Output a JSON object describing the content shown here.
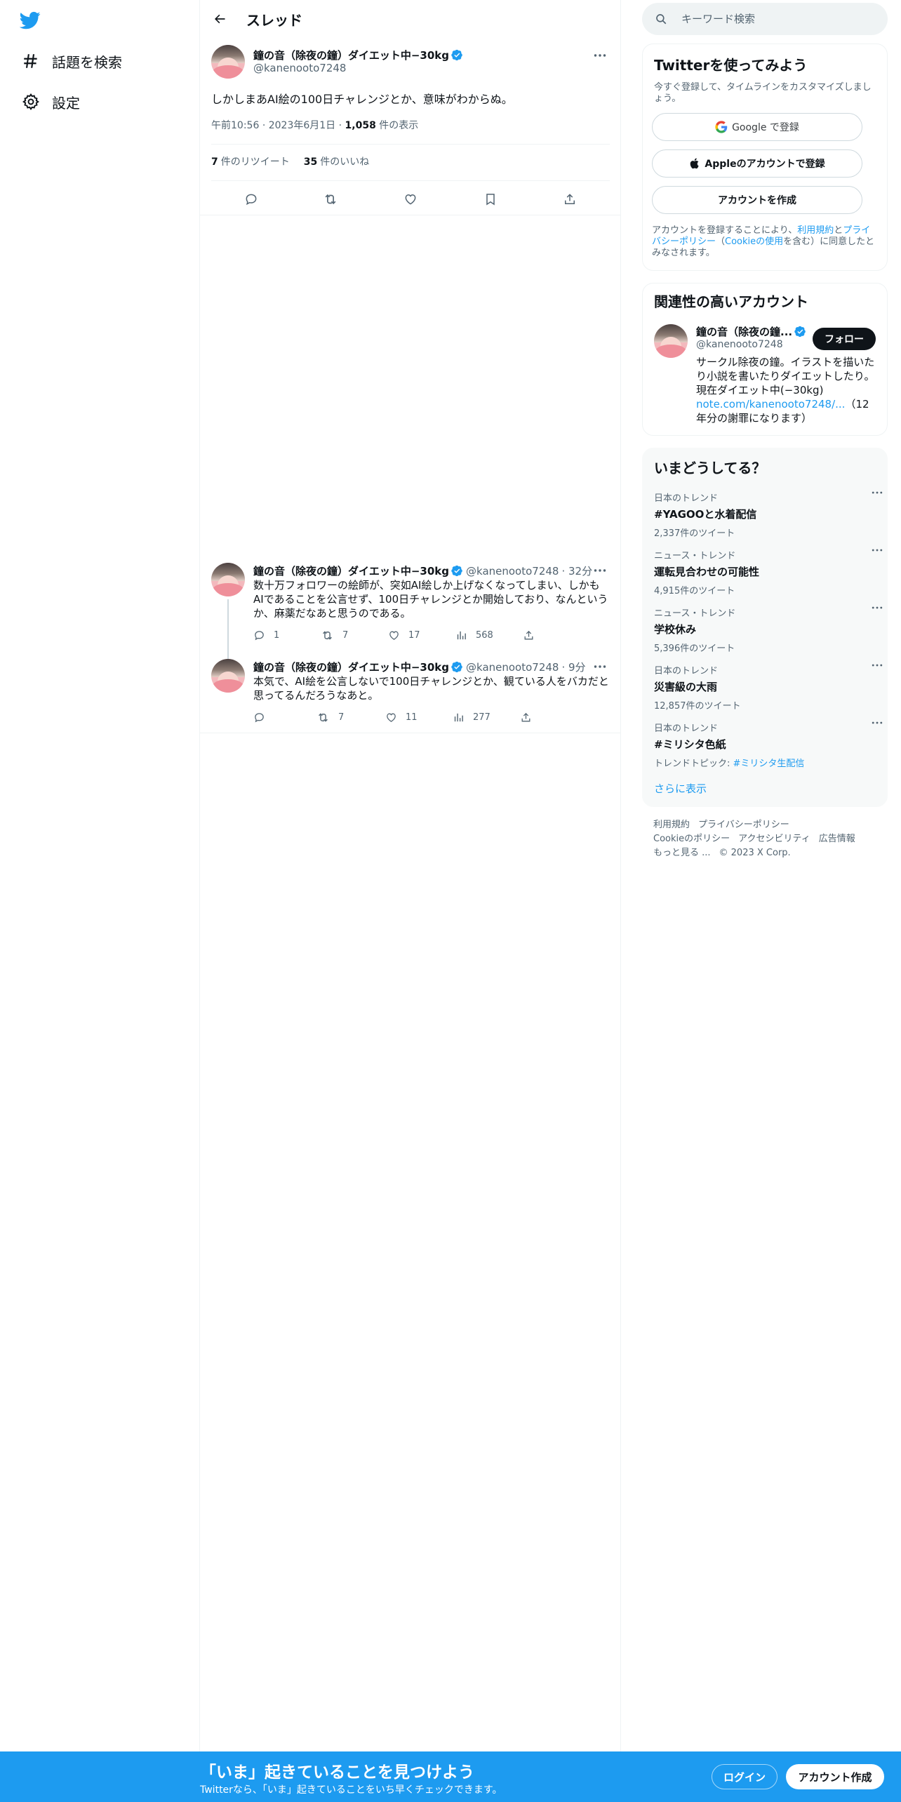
{
  "nav": {
    "explore_label": "話題を検索",
    "settings_label": "設定"
  },
  "thread": {
    "title": "スレッド",
    "focal": {
      "name": "鐘の音（除夜の鐘）ダイエット中−30kg",
      "handle": "@kanenooto7248",
      "text": "しかしまあAI絵の100日チャレンジとか、意味がわからぬ。",
      "time": "午前10:56",
      "date": "2023年6月1日",
      "views_count": "1,058",
      "views_label": " 件の表示",
      "retweets_count": "7",
      "retweets_label": "件のリツイート",
      "likes_count": "35",
      "likes_label": "件のいいね"
    },
    "replies": [
      {
        "name": "鐘の音（除夜の鐘）ダイエット中−30kg",
        "handle": "@kanenooto7248",
        "time": "· 32分",
        "text": "数十万フォロワーの絵師が、突如AI絵しか上げなくなってしまい、しかもAIであることを公言せず、100日チャレンジとか開始しており、なんというか、麻薬だなあと思うのである。",
        "replies": "1",
        "retweets": "7",
        "likes": "17",
        "views": "568"
      },
      {
        "name": "鐘の音（除夜の鐘）ダイエット中−30kg",
        "handle": "@kanenooto7248",
        "time": "· 9分",
        "text": "本気で、AI絵を公言しないで100日チャレンジとか、観ている人をバカだと思ってるんだろうなあと。",
        "replies": "",
        "retweets": "7",
        "likes": "11",
        "views": "277"
      }
    ]
  },
  "search": {
    "placeholder": "キーワード検索"
  },
  "signup": {
    "title": "Twitterを使ってみよう",
    "subtitle": "今すぐ登録して、タイムラインをカスタマイズしましょう。",
    "google_label": "Google で登録",
    "apple_label": "Appleのアカウントで登録",
    "create_label": "アカウントを作成",
    "tos_prefix": "アカウントを登録することにより、",
    "tos_terms": "利用規約",
    "tos_and": "と",
    "tos_privacy": "プライバシーポリシー",
    "tos_paren_open": "（",
    "tos_cookie": "Cookieの使用",
    "tos_suffix": "を含む）に同意したとみなされます。"
  },
  "related": {
    "title": "関連性の高いアカウント",
    "name": "鐘の音（除夜の鐘...",
    "handle": "@kanenooto7248",
    "follow_label": "フォロー",
    "bio_text": "サークル除夜の鐘。イラストを描いたり小説を書いたりダイエットしたり。現在ダイエット中(−30kg)",
    "bio_link": "note.com/kanenooto7248/...",
    "bio_tail": "（12年分の謝罪になります）"
  },
  "trends": {
    "title": "いまどうしてる？",
    "items": [
      {
        "context": "日本のトレンド",
        "title": "#YAGOOと水着配信",
        "count": "2,337件のツイート",
        "topic_prefix": "",
        "topic_link": ""
      },
      {
        "context": "ニュース・トレンド",
        "title": "運転見合わせの可能性",
        "count": "4,915件のツイート",
        "topic_prefix": "",
        "topic_link": ""
      },
      {
        "context": "ニュース・トレンド",
        "title": "学校休み",
        "count": "5,396件のツイート",
        "topic_prefix": "",
        "topic_link": ""
      },
      {
        "context": "日本のトレンド",
        "title": "災害級の大雨",
        "count": "12,857件のツイート",
        "topic_prefix": "",
        "topic_link": ""
      },
      {
        "context": "日本のトレンド",
        "title": "#ミリシタ色紙",
        "count": "",
        "topic_prefix": "トレンドトピック: ",
        "topic_link": "#ミリシタ生配信"
      }
    ],
    "show_more": "さらに表示"
  },
  "footer": {
    "terms": "利用規約",
    "privacy": "プライバシーポリシー",
    "cookies": "Cookieのポリシー",
    "accessibility": "アクセシビリティ",
    "ads": "広告情報",
    "more": "もっと見る ...",
    "copyright": "© 2023 X Corp."
  },
  "bottom": {
    "title": "「いま」起きていることを見つけよう",
    "subtitle": "Twitterなら、「いま」起きていることをいち早くチェックできます。",
    "login_label": "ログイン",
    "signup_label": "アカウント作成"
  },
  "colors": {
    "accent": "#1d9bf0",
    "text": "#0f1419",
    "muted": "#536471"
  }
}
